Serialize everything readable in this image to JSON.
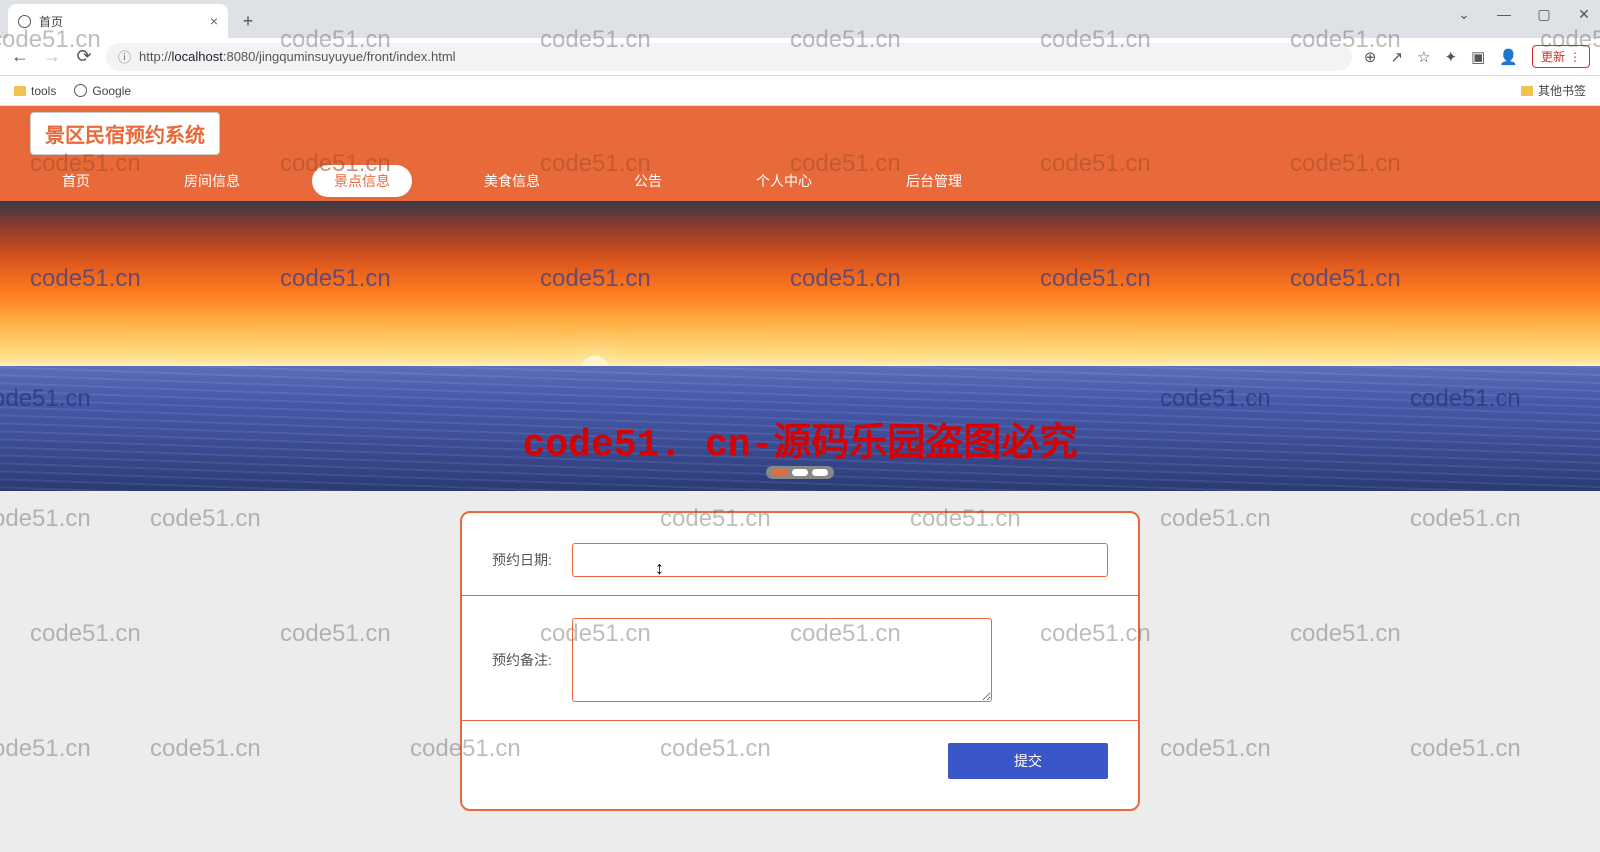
{
  "browser": {
    "tab_title": "首页",
    "url_host": "localhost",
    "url_port": ":8080",
    "url_path": "/jingquminsuyuyue/front/index.html",
    "url_prefix": "http://",
    "update_label": "更新",
    "bookmarks": {
      "tools": "tools",
      "google": "Google",
      "other": "其他书签"
    }
  },
  "site": {
    "title": "景区民宿预约系统"
  },
  "nav": {
    "items": [
      {
        "label": "首页",
        "active": false
      },
      {
        "label": "房间信息",
        "active": false
      },
      {
        "label": "景点信息",
        "active": true
      },
      {
        "label": "美食信息",
        "active": false
      },
      {
        "label": "公告",
        "active": false
      },
      {
        "label": "个人中心",
        "active": false
      },
      {
        "label": "后台管理",
        "active": false
      }
    ]
  },
  "carousel": {
    "watermark": "code51. cn-源码乐园盗图必究"
  },
  "form": {
    "date_label": "预约日期:",
    "date_value": "",
    "note_label": "预约备注:",
    "note_value": "",
    "submit_label": "提交"
  },
  "watermark_text": "code51.cn"
}
